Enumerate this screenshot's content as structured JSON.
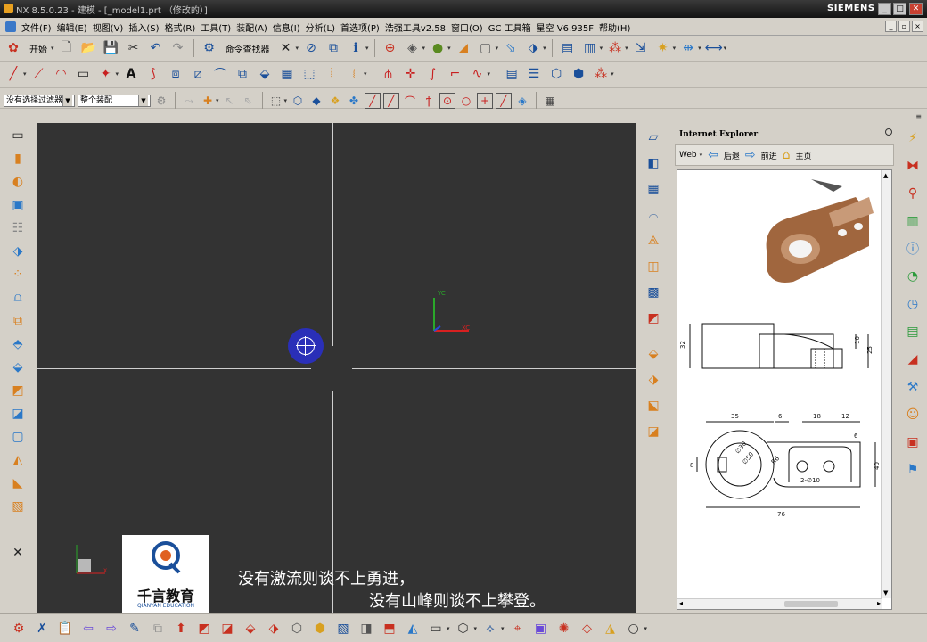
{
  "window": {
    "title": "NX 8.5.0.23 - 建模 - [_model1.prt （修改的）]",
    "brand": "SIEMENS",
    "controls": [
      "_",
      "□",
      "✕"
    ]
  },
  "menu": {
    "items": [
      "文件(F)",
      "编辑(E)",
      "视图(V)",
      "插入(S)",
      "格式(R)",
      "工具(T)",
      "装配(A)",
      "信息(I)",
      "分析(L)",
      "首选项(P)",
      "浩强工具v2.58",
      "窗口(O)",
      "GC 工具箱",
      "星空 V6.935F",
      "帮助(H)"
    ]
  },
  "toolbar1": {
    "start_label": "开始",
    "command_finder_label": "命令查找器"
  },
  "toolbar3": {
    "filter_value": "没有选择过滤器",
    "assembly_value": "整个装配"
  },
  "viewport": {
    "axis_top_label": "YC",
    "axis_right_label": "XC",
    "mini_axis_label": "X",
    "logo_cn": "千言教育",
    "logo_en": "QIANYAN EDUCATION",
    "subtitle_line1": "没有激流则谈不上勇进，",
    "subtitle_line2": "没有山峰则谈不上攀登。"
  },
  "ie_panel": {
    "title": "Internet Explorer",
    "web_label": "Web",
    "back_label": "后退",
    "forward_label": "前进",
    "home_label": "主页"
  },
  "drawing": {
    "dims": {
      "d35": "35",
      "d6a": "6",
      "d18": "18",
      "d12": "12",
      "d6b": "6",
      "d8": "8",
      "d40": "40",
      "d76": "76",
      "d32": "32",
      "d10": "10",
      "d25": "25",
      "r6": "R6",
      "phi10": "2-∅10",
      "phi30": "∅30",
      "phi50": "∅50"
    }
  },
  "colors": {
    "viewport_bg": "#333333",
    "panel_bg": "#d4d0c8",
    "part_color": "#a0663e",
    "cursor_blue": "#2a2fb8"
  }
}
